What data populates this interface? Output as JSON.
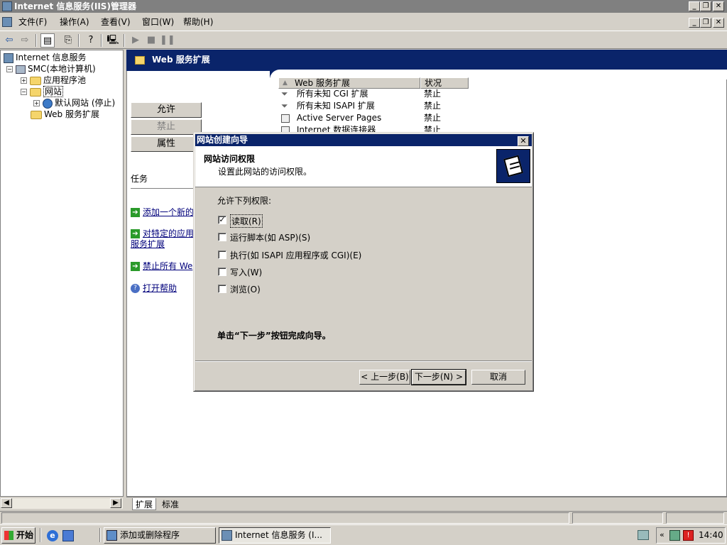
{
  "window": {
    "title": "Internet 信息服务(IIS)管理器"
  },
  "menu": [
    "文件(F)",
    "操作(A)",
    "查看(V)",
    "窗口(W)",
    "帮助(H)"
  ],
  "tree": {
    "root": "Internet 信息服务",
    "computer": "SMC(本地计算机)",
    "app_pools": "应用程序池",
    "websites": "网站",
    "default_site": "默认网站 (停止)",
    "web_ext": "Web 服务扩展"
  },
  "panel": {
    "banner": "Web 服务扩展",
    "allow_btn": "允许",
    "deny_btn": "禁止",
    "props_btn": "属性",
    "tasks_label": "任务",
    "task1": "添加一个新的",
    "task2a": "对特定的应用",
    "task2b": "服务扩展",
    "task3": "禁止所有 We",
    "task4": "打开帮助"
  },
  "list": {
    "col_ext": "Web 服务扩展",
    "col_status": "状况",
    "rows": [
      {
        "name": "所有未知 CGI 扩展",
        "status": "禁止"
      },
      {
        "name": "所有未知 ISAPI 扩展",
        "status": "禁止"
      },
      {
        "name": "Active Server Pages",
        "status": "禁止"
      },
      {
        "name": "Internet 数据连接器",
        "status": "禁止"
      }
    ]
  },
  "dialog": {
    "title": "网站创建向导",
    "heading": "网站访问权限",
    "subheading": "设置此网站的访问权限。",
    "allow_label": "允许下列权限:",
    "options": [
      {
        "label": "读取(R)",
        "checked": true
      },
      {
        "label": "运行脚本(如 ASP)(S)",
        "checked": false
      },
      {
        "label": "执行(如 ISAPI 应用程序或 CGI)(E)",
        "checked": false
      },
      {
        "label": "写入(W)",
        "checked": false
      },
      {
        "label": "浏览(O)",
        "checked": false
      }
    ],
    "hint": "单击“下一步”按钮完成向导。",
    "back_btn": "< 上一步(B)",
    "next_btn": "下一步(N) >",
    "cancel_btn": "取消"
  },
  "tabs": [
    "扩展",
    "标准"
  ],
  "taskbar": {
    "start": "开始",
    "task1": "添加或删除程序",
    "task2": "Internet 信息服务 (I...",
    "clock": "14:40"
  }
}
